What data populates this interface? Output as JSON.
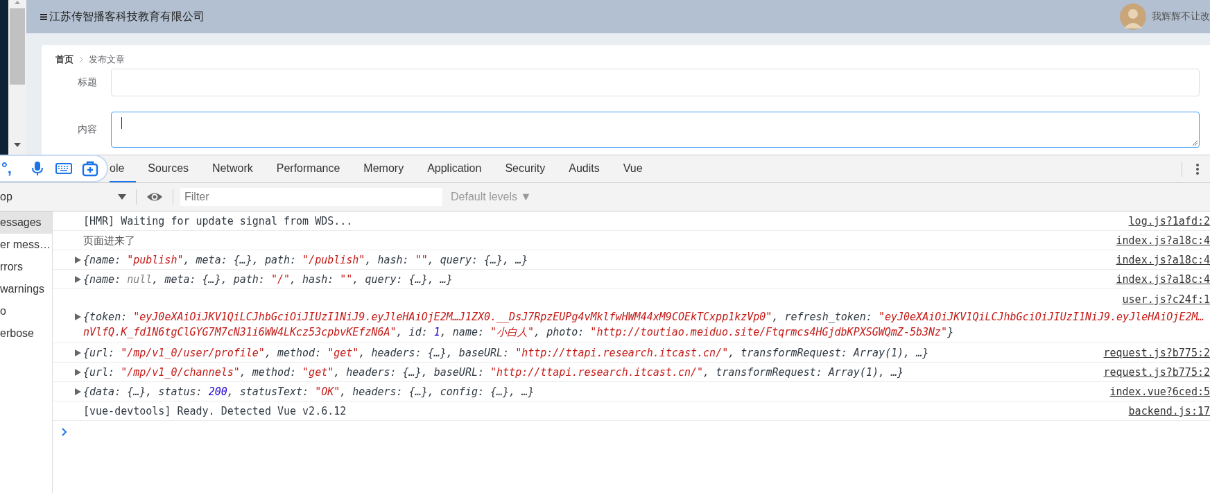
{
  "header": {
    "title": "江苏传智播客科技教育有限公司",
    "user_name": "我辉辉不让改"
  },
  "breadcrumb": [
    {
      "label": "首页",
      "current": false
    },
    {
      "label": "发布文章",
      "current": true
    }
  ],
  "form": [
    {
      "label": "标题",
      "kind": "input",
      "focused": false
    },
    {
      "label": "内容",
      "kind": "textarea",
      "focused": true
    }
  ],
  "devtools": {
    "tabs": [
      {
        "label": "ole",
        "selected": true
      },
      {
        "label": "Sources",
        "selected": false
      },
      {
        "label": "Network",
        "selected": false
      },
      {
        "label": "Performance",
        "selected": false
      },
      {
        "label": "Memory",
        "selected": false
      },
      {
        "label": "Application",
        "selected": false
      },
      {
        "label": "Security",
        "selected": false
      },
      {
        "label": "Audits",
        "selected": false
      },
      {
        "label": "Vue",
        "selected": false
      }
    ],
    "ime_toolbar": {
      "punctuation": "°,"
    },
    "context": "op",
    "filter_placeholder": "Filter",
    "levels": "Default levels ▼",
    "sidebar": [
      {
        "label": "essages",
        "selected": true
      },
      {
        "label": "er mess…",
        "selected": false
      },
      {
        "label": "rrors",
        "selected": false
      },
      {
        "label": "warnings",
        "selected": false
      },
      {
        "label": "o",
        "selected": false
      },
      {
        "label": "erbose",
        "selected": false
      }
    ],
    "messages": [
      {
        "kind": "log",
        "source": "log.js?1afd:2",
        "tokens": [
          {
            "kind": "plain",
            "t": "[HMR] Waiting for update signal from WDS..."
          }
        ]
      },
      {
        "kind": "text",
        "source": "index.js?a18c:4",
        "tokens": [
          {
            "kind": "plain",
            "t": "页面进来了"
          }
        ]
      },
      {
        "kind": "object",
        "expanded": false,
        "source": "index.js?a18c:4",
        "tokens": [
          {
            "kind": "plain",
            "t": "{name: "
          },
          {
            "kind": "string",
            "t": "\"publish\""
          },
          {
            "kind": "plain",
            "t": ", meta: {…}, path: "
          },
          {
            "kind": "string",
            "t": "\"/publish\""
          },
          {
            "kind": "plain",
            "t": ", hash: "
          },
          {
            "kind": "string",
            "t": "\"\""
          },
          {
            "kind": "plain",
            "t": ", query: {…}, …}"
          }
        ]
      },
      {
        "kind": "object",
        "expanded": false,
        "source": "index.js?a18c:4",
        "tokens": [
          {
            "kind": "plain",
            "t": "{name: "
          },
          {
            "kind": "null",
            "t": "null"
          },
          {
            "kind": "plain",
            "t": ", meta: {…}, path: "
          },
          {
            "kind": "string",
            "t": "\"/\""
          },
          {
            "kind": "plain",
            "t": ", hash: "
          },
          {
            "kind": "string",
            "t": "\"\""
          },
          {
            "kind": "plain",
            "t": ", query: {…}, …}"
          }
        ]
      },
      {
        "kind": "object",
        "expanded": false,
        "source": "user.js?c24f:1",
        "source_above": true,
        "tokens": [
          {
            "kind": "plain",
            "t": "{token: "
          },
          {
            "kind": "string",
            "t": "\"eyJ0eXAiOiJKV1QiLCJhbGciOiJIUzI1NiJ9.eyJleHAiOjE2M…J1ZX0.__DsJ7RpzEUPg4vMklfwHWM44xM9COEkTCxpp1kzVp0\""
          },
          {
            "kind": "plain",
            "t": ", refresh_token: "
          },
          {
            "kind": "string",
            "t": "\"eyJ0eXAiOiJKV1QiLCJhbGciOiJIUzI1NiJ9.eyJleHAiOjE2M…nVlfQ.K_fd1N6tgClGYG7M7cN31i6WW4LKcz53cpbvKEfzN6A\""
          },
          {
            "kind": "plain",
            "t": ", id: "
          },
          {
            "kind": "number",
            "t": "1"
          },
          {
            "kind": "plain",
            "t": ", name: "
          },
          {
            "kind": "string",
            "t": "\"小白人\""
          },
          {
            "kind": "plain",
            "t": ", photo: "
          },
          {
            "kind": "string",
            "t": "\"http://toutiao.meiduo.site/Ftqrmcs4HGjdbKPXSGWQmZ-5b3Nz\""
          },
          {
            "kind": "plain",
            "t": "}"
          }
        ]
      },
      {
        "kind": "object",
        "expanded": false,
        "source": "request.js?b775:2",
        "tokens": [
          {
            "kind": "plain",
            "t": "{url: "
          },
          {
            "kind": "string",
            "t": "\"/mp/v1_0/user/profile\""
          },
          {
            "kind": "plain",
            "t": ", method: "
          },
          {
            "kind": "string",
            "t": "\"get\""
          },
          {
            "kind": "plain",
            "t": ", headers: {…}, baseURL: "
          },
          {
            "kind": "string",
            "t": "\"http://ttapi.research.itcast.cn/\""
          },
          {
            "kind": "plain",
            "t": ", transformRequest: Array(1), …}"
          }
        ]
      },
      {
        "kind": "object",
        "expanded": false,
        "source": "request.js?b775:2",
        "tokens": [
          {
            "kind": "plain",
            "t": "{url: "
          },
          {
            "kind": "string",
            "t": "\"/mp/v1_0/channels\""
          },
          {
            "kind": "plain",
            "t": ", method: "
          },
          {
            "kind": "string",
            "t": "\"get\""
          },
          {
            "kind": "plain",
            "t": ", headers: {…}, baseURL: "
          },
          {
            "kind": "string",
            "t": "\"http://ttapi.research.itcast.cn/\""
          },
          {
            "kind": "plain",
            "t": ", transformRequest: Array(1), …}"
          }
        ]
      },
      {
        "kind": "object",
        "expanded": false,
        "source": "index.vue?6ced:5",
        "tokens": [
          {
            "kind": "plain",
            "t": "{data: {…}, status: "
          },
          {
            "kind": "number",
            "t": "200"
          },
          {
            "kind": "plain",
            "t": ", statusText: "
          },
          {
            "kind": "string",
            "t": "\"OK\""
          },
          {
            "kind": "plain",
            "t": ", headers: {…}, config: {…}, …}"
          }
        ]
      },
      {
        "kind": "log",
        "source": "backend.js:17",
        "tokens": [
          {
            "kind": "plain",
            "t": "[vue-devtools] Ready. Detected Vue v2.6.12"
          }
        ]
      }
    ]
  }
}
